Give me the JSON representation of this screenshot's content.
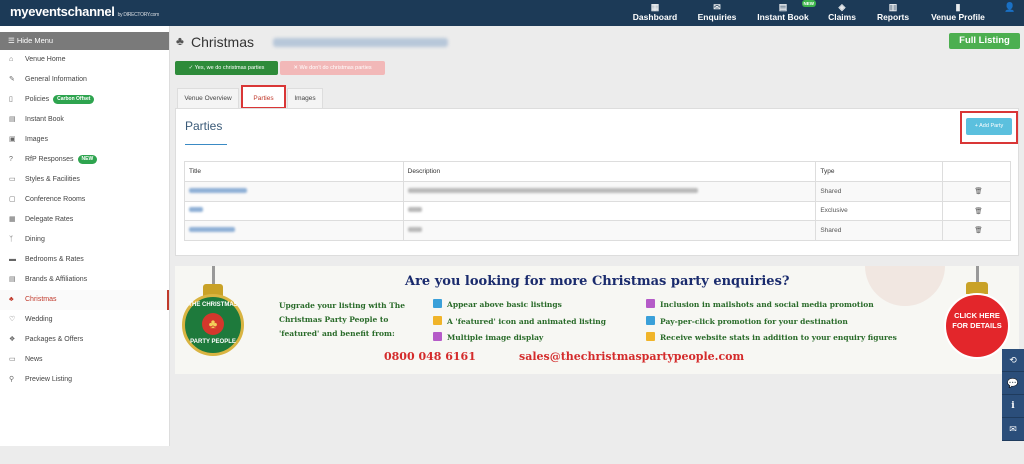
{
  "brand": {
    "name": "myeventschannel",
    "by": "by DIRECTORY.com"
  },
  "nav": [
    {
      "label": "Dashboard",
      "icon": "dashboard-icon",
      "glyph": "▦"
    },
    {
      "label": "Enquiries",
      "icon": "envelope-icon",
      "glyph": "✉",
      "badge": "NEW"
    },
    {
      "label": "Instant Book",
      "icon": "calendar-icon",
      "glyph": "▤"
    },
    {
      "label": "Claims",
      "icon": "claims-icon",
      "glyph": "◈"
    },
    {
      "label": "Reports",
      "icon": "bar-chart-icon",
      "glyph": "▥"
    },
    {
      "label": "Venue Profile",
      "icon": "profile-icon",
      "glyph": "▮"
    },
    {
      "label": "",
      "icon": "user-icon",
      "glyph": "👤"
    }
  ],
  "sidebar": {
    "hide_menu": "Hide Menu",
    "items": [
      {
        "label": "Venue Home",
        "icon": "home-icon",
        "glyph": "⌂"
      },
      {
        "label": "General Information",
        "icon": "edit-icon",
        "glyph": "✎"
      },
      {
        "label": "Policies",
        "icon": "document-icon",
        "glyph": "▯",
        "pill": "Carbon Offset"
      },
      {
        "label": "Instant Book",
        "icon": "calendar-icon",
        "glyph": "▤"
      },
      {
        "label": "Images",
        "icon": "image-icon",
        "glyph": "▣"
      },
      {
        "label": "RfP Responses",
        "icon": "question-icon",
        "glyph": "?",
        "pill": "NEW"
      },
      {
        "label": "Styles & Facilities",
        "icon": "monitor-icon",
        "glyph": "▭"
      },
      {
        "label": "Conference Rooms",
        "icon": "room-icon",
        "glyph": "▢"
      },
      {
        "label": "Delegate Rates",
        "icon": "rates-icon",
        "glyph": "▦"
      },
      {
        "label": "Dining",
        "icon": "cutlery-icon",
        "glyph": "ᛉ"
      },
      {
        "label": "Bedrooms & Rates",
        "icon": "bed-icon",
        "glyph": "▬"
      },
      {
        "label": "Brands & Affiliations",
        "icon": "brand-icon",
        "glyph": "▤"
      },
      {
        "label": "Christmas",
        "icon": "tree-icon",
        "glyph": "♣",
        "active": true
      },
      {
        "label": "Wedding",
        "icon": "heart-icon",
        "glyph": "♡"
      },
      {
        "label": "Packages & Offers",
        "icon": "gift-icon",
        "glyph": "❖"
      },
      {
        "label": "News",
        "icon": "news-icon",
        "glyph": "▭"
      },
      {
        "label": "Preview Listing",
        "icon": "search-icon",
        "glyph": "⚲"
      }
    ]
  },
  "page": {
    "title": "Christmas",
    "full_listing": "Full Listing",
    "yes_button": "✓ Yes, we do christmas parties",
    "no_button": "✕ We don't do christmas parties",
    "tabs": [
      "Venue Overview",
      "Parties",
      "Images"
    ],
    "active_tab": 1
  },
  "parties": {
    "heading": "Parties",
    "add_button": "+ Add Party",
    "columns": [
      "Title",
      "Description",
      "Type"
    ],
    "rows": [
      {
        "type": "Shared"
      },
      {
        "type": "Exclusive"
      },
      {
        "type": "Shared"
      }
    ]
  },
  "banner": {
    "headline": "Are you looking for more Christmas party enquiries?",
    "lead": "Upgrade your listing with The Christmas Party People to 'featured' and benefit from:",
    "features_left": [
      "Appear above basic listings",
      "A 'featured' icon and animated listing",
      "Multiple image display"
    ],
    "features_right": [
      "Inclusion in mailshots and social media promotion",
      "Pay-per-click promotion for your destination",
      "Receive website stats in addition to your enquiry figures"
    ],
    "phone": "0800 048 6161",
    "email": "sales@thechristmaspartypeople.com",
    "logo_top": "THE CHRISTMAS",
    "logo_bottom": "PARTY PEOPLE",
    "cta": "CLICK HERE FOR DETAILS"
  },
  "floating": [
    {
      "icon": "history-icon",
      "glyph": "⟲"
    },
    {
      "icon": "chat-icon",
      "glyph": "💬"
    },
    {
      "icon": "info-icon",
      "glyph": "i"
    },
    {
      "icon": "mail-icon",
      "glyph": "✉"
    }
  ],
  "colors": {
    "nav_bg": "#1c3a57",
    "accent_red": "#c0392b",
    "success": "#4caf50",
    "info": "#5bc0de"
  }
}
